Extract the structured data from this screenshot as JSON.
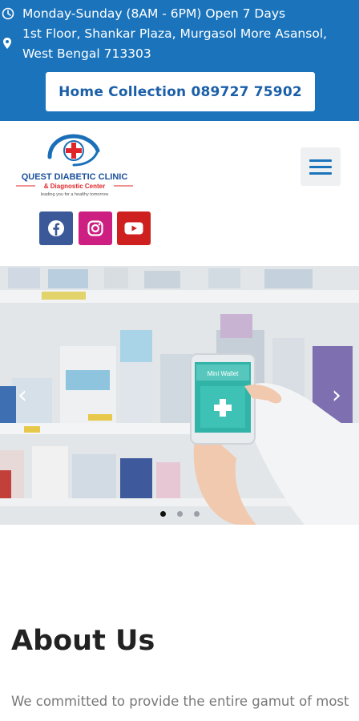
{
  "topbar": {
    "hours": "Monday-Sunday (8AM - 6PM) Open 7 Days",
    "address_line1": "1st Floor, Shankar Plaza, Murgasol More Asansol,",
    "address_line2": "West Bengal 713303",
    "home_collection": "Home Collection 089727 75902",
    "bg_color": "#1b74bb"
  },
  "logo": {
    "name": "QUEST DIABETIC CLINIC",
    "sub": "& Diagnostic Center",
    "tagline": "leading you for a healthy tomorrow"
  },
  "menu": {
    "icon": "hamburger-menu-icon"
  },
  "social": [
    {
      "name": "facebook-icon",
      "color": "#3b5998"
    },
    {
      "name": "instagram-icon",
      "color": "#cc1f81"
    },
    {
      "name": "youtube-icon",
      "color": "#cd201f"
    }
  ],
  "slider": {
    "phone_screen_text": "Mini Wallet",
    "prev": "‹",
    "next": "›",
    "slides": 3,
    "active_slide": 1
  },
  "about": {
    "title": "About Us",
    "text": "We committed to provide the entire gamut of most"
  }
}
